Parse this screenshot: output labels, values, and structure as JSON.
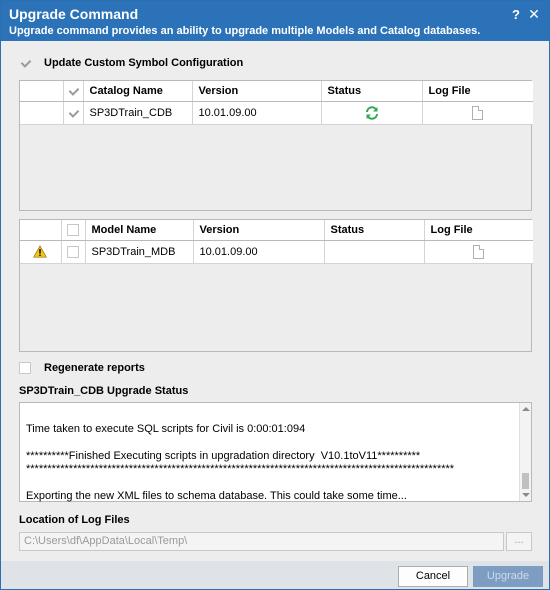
{
  "window": {
    "title": "Upgrade Command",
    "subtitle": "Upgrade command provides an ability to upgrade multiple Models and Catalog databases.",
    "help_glyph": "?",
    "close_glyph": "✕"
  },
  "update_custom_symbol": {
    "label": "Update Custom Symbol Configuration",
    "checked": true
  },
  "catalog_grid": {
    "columns": [
      "Catalog Name",
      "Version",
      "Status",
      "Log File"
    ],
    "rows": [
      {
        "name": "SP3DTrain_CDB",
        "version": "10.01.09.00",
        "checked": true,
        "status_icon": "refresh-icon",
        "log_icon": "file-icon"
      }
    ]
  },
  "model_grid": {
    "columns": [
      "Model Name",
      "Version",
      "Status",
      "Log File"
    ],
    "rows": [
      {
        "name": "SP3DTrain_MDB",
        "version": "10.01.09.00",
        "checked": false,
        "warning_icon": "warning-icon",
        "log_icon": "file-icon"
      }
    ]
  },
  "regenerate_reports": {
    "label": "Regenerate reports",
    "checked": false
  },
  "upgrade_status": {
    "label": "SP3DTrain_CDB Upgrade Status",
    "lines": [
      "Time taken to execute SQL scripts for Civil is 0:00:01:094",
      "",
      "**********Finished Executing scripts in upgradation directory  V10.1toV11**********",
      "****************************************************************************************************",
      "",
      "Exporting the new XML files to schema database. This could take some time..."
    ]
  },
  "log_location": {
    "label": "Location of Log Files",
    "value": "C:\\Users\\df\\AppData\\Local\\Temp\\",
    "browse_label": "..."
  },
  "footer": {
    "cancel_label": "Cancel",
    "upgrade_label": "Upgrade"
  },
  "colors": {
    "titlebar": "#2b72b9",
    "refresh_green": "#2fa84f",
    "warning_yellow": "#f0c419",
    "upgrade_disabled": "#7d9ec2"
  }
}
